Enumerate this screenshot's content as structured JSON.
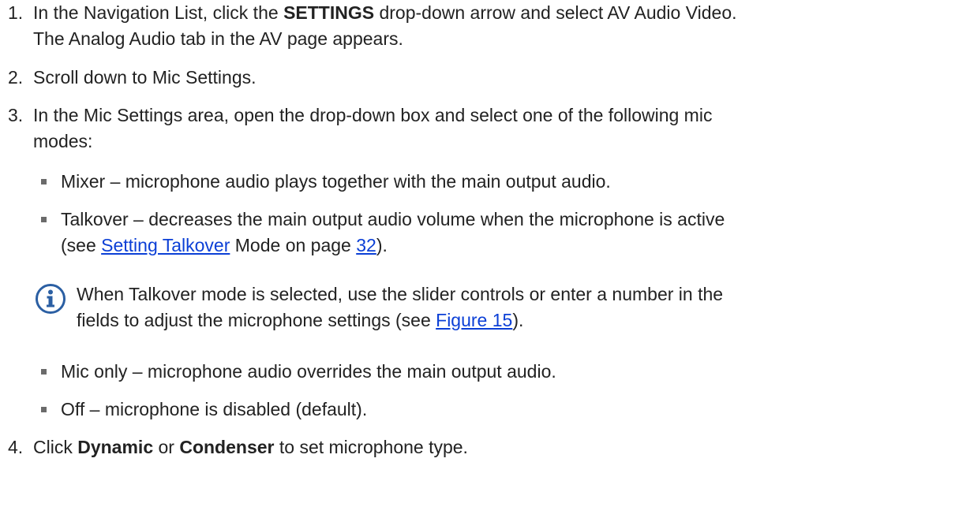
{
  "steps": [
    {
      "number": "1.",
      "pre": "In the Navigation List, click the ",
      "bold": "SETTINGS",
      "post": " drop-down arrow and select AV Audio Video.",
      "line2": "The Analog Audio tab in the AV page appears."
    },
    {
      "number": "2.",
      "text": "Scroll down to Mic Settings."
    },
    {
      "number": "3.",
      "line1": "In the Mic Settings area, open the drop-down box and select one of the following mic",
      "line2": "modes:"
    },
    {
      "number": "4.",
      "pre": "Click ",
      "bold1": "Dynamic",
      "mid": " or ",
      "bold2": "Condenser",
      "post": " to set microphone type."
    }
  ],
  "modes": [
    {
      "text": "Mixer – microphone audio plays together with the main output audio."
    },
    {
      "line1": "Talkover – decreases the main output audio volume when the microphone is active",
      "line2_pre": "(see ",
      "link1": "Setting Talkover",
      "line2_mid": " Mode on page ",
      "link2": "32",
      "line2_post": ")."
    },
    {
      "text": "Mic only – microphone audio overrides the main output audio."
    },
    {
      "text": "Off – microphone is disabled (default)."
    }
  ],
  "note": {
    "icon": "info-icon",
    "line1": "When Talkover mode is selected, use the slider controls or enter a number in the",
    "line2_pre": "fields to adjust the microphone settings (see ",
    "link": "Figure 15",
    "line2_post": ")."
  },
  "colors": {
    "text": "#222222",
    "link": "#0b3fd6",
    "icon": "#2b5fa3",
    "bullet": "#6b6b6b"
  }
}
